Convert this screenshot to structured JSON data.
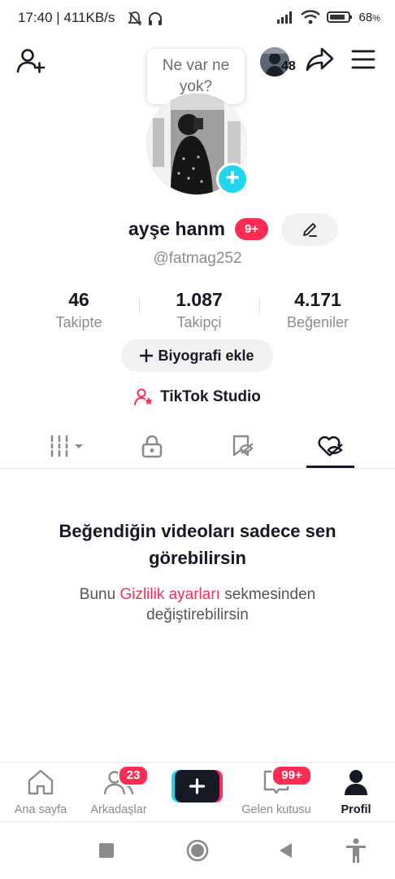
{
  "status_bar": {
    "time": "17:40 | 411KB/s",
    "battery": "68",
    "battery_unit": "%"
  },
  "header": {
    "bubble_text": "Ne var ne yok?",
    "mini_avatar_count": "48"
  },
  "profile": {
    "display_name": "ayşe hanm",
    "name_badge": "9+",
    "username": "@fatmag252"
  },
  "stats": [
    {
      "value": "46",
      "label": "Takipte"
    },
    {
      "value": "1.087",
      "label": "Takipçi"
    },
    {
      "value": "4.171",
      "label": "Beğeniler"
    }
  ],
  "actions": {
    "bio_button": "Biyografi ekle",
    "studio_link": "TikTok Studio"
  },
  "tabs": [
    {
      "icon": "grid-icon"
    },
    {
      "icon": "lock-icon"
    },
    {
      "icon": "bookmark-icon"
    },
    {
      "icon": "liked-hidden-icon",
      "active": true
    }
  ],
  "empty_state": {
    "title": "Beğendiğin videoları sadece sen görebilirsin",
    "sub_before": "Bunu ",
    "sub_link": "Gizlilik ayarları",
    "sub_after": " sekmesinden değiştirebilirsin"
  },
  "bottom_nav": [
    {
      "label": "Ana sayfa",
      "icon": "home-icon"
    },
    {
      "label": "Arkadaşlar",
      "icon": "friends-icon",
      "badge": "23"
    },
    {
      "label": "",
      "icon": "create-icon"
    },
    {
      "label": "Gelen kutusu",
      "icon": "inbox-icon",
      "badge": "99+"
    },
    {
      "label": "Profil",
      "icon": "profile-icon",
      "active": true
    }
  ],
  "colors": {
    "accent": "#fe2c55",
    "cyan": "#20d5ec",
    "text": "#161823",
    "muted": "#8a8b91"
  }
}
